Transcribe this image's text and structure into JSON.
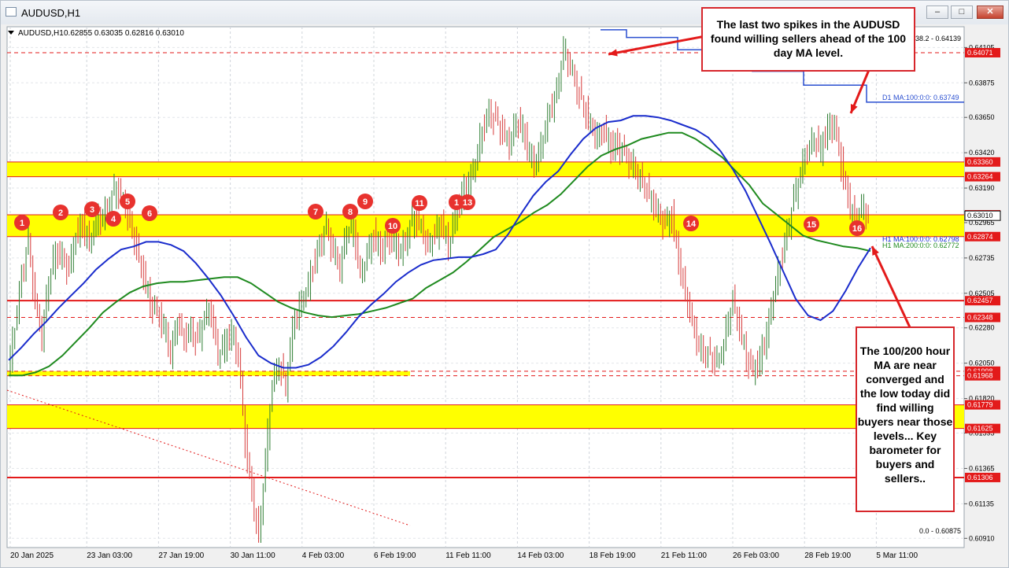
{
  "window": {
    "title": "AUDUSD,H1",
    "buttons": [
      "minimize",
      "maximize",
      "close"
    ]
  },
  "header_info": {
    "symbol": "AUDUSD,H1",
    "ohlc": "0.62855 0.63035 0.62816 0.63010",
    "fib_top_label": "38.2 - 0.64139",
    "fib_bottom_label": "0.0 - 0.60875"
  },
  "annotations": {
    "top": "The last two spikes in the AUDUSD found willing sellers ahead of the 100 day MA level.",
    "bottom": "The 100/200 hour MA are near converged and the low today did find willing buyers near those levels... Key barometer for buyers and sellers.."
  },
  "colors": {
    "price_up": "#2e7d32",
    "price_down": "#d63a3a",
    "ma100h": "#1a2ccc",
    "ma200h": "#1f8a1f",
    "d1ma": "#2a4fd0",
    "zone": "#ffff00",
    "level": "#e31a1a",
    "marker": "#e8322e"
  },
  "chart_data": {
    "type": "candlestick",
    "symbol": "AUDUSD",
    "timeframe": "H1",
    "y_range": [
      0.6085,
      0.6424
    ],
    "y_ticks": [
      "0.64105",
      "0.63875",
      "0.63650",
      "0.63420",
      "0.63190",
      "0.62965",
      "0.62735",
      "0.62505",
      "0.62280",
      "0.62050",
      "0.61820",
      "0.61595",
      "0.61365",
      "0.61135",
      "0.60910"
    ],
    "x_labels": [
      "20 Jan 2025",
      "23 Jan 03:00",
      "27 Jan 19:00",
      "30 Jan 11:00",
      "4 Feb 03:00",
      "6 Feb 19:00",
      "11 Feb 11:00",
      "14 Feb 03:00",
      "18 Feb 19:00",
      "21 Feb 11:00",
      "26 Feb 03:00",
      "28 Feb 19:00",
      "5 Mar 11:00"
    ],
    "highlighted_levels": [
      {
        "price": 0.64071,
        "label": "0.64071",
        "style": "dashed"
      },
      {
        "price": 0.6336,
        "label": "0.63360",
        "style": "zone-top"
      },
      {
        "price": 0.63264,
        "label": "0.63264",
        "style": "zone-bottom"
      },
      {
        "price": 0.63016,
        "label": "0.63016",
        "style": "zone-top"
      },
      {
        "price": 0.62874,
        "label": "0.62874",
        "style": "zone-bottom"
      },
      {
        "price": 0.62457,
        "label": "0.62457",
        "style": "solid"
      },
      {
        "price": 0.62348,
        "label": "0.62348",
        "style": "dashed"
      },
      {
        "price": 0.61998,
        "label": "0.61998",
        "style": "dashed"
      },
      {
        "price": 0.61968,
        "label": "0.61968",
        "style": "dashed"
      },
      {
        "price": 0.61779,
        "label": "0.61779",
        "style": "zone-top"
      },
      {
        "price": 0.61625,
        "label": "0.61625",
        "style": "zone-bottom"
      },
      {
        "price": 0.61306,
        "label": "0.61306",
        "style": "solid"
      }
    ],
    "current_price": 0.6301,
    "indicators": [
      {
        "name": "D1 MA:100:0:0",
        "value": 0.63749,
        "label": "D1 MA:100:0:0: 0.63749"
      },
      {
        "name": "H1 MA:100:0:0",
        "value": 0.62798,
        "label": "H1 MA:100:0:0: 0.62798"
      },
      {
        "name": "H1 MA:200:0:0",
        "value": 0.62772,
        "label": "H1 MA:200:0:0: 0.62772"
      }
    ],
    "markers": [
      "1",
      "2",
      "3",
      "4",
      "5",
      "6",
      "7",
      "8",
      "9",
      "10",
      "11",
      "1",
      "13",
      "14",
      "15",
      "16"
    ],
    "price_path": [
      0.6199,
      0.6228,
      0.6262,
      0.6282,
      0.6245,
      0.6223,
      0.6258,
      0.6278,
      0.6274,
      0.6265,
      0.6288,
      0.6295,
      0.6282,
      0.6298,
      0.63,
      0.631,
      0.632,
      0.631,
      0.6296,
      0.6278,
      0.6262,
      0.6245,
      0.6238,
      0.6229,
      0.6212,
      0.6232,
      0.6222,
      0.6226,
      0.6218,
      0.6235,
      0.6239,
      0.621,
      0.6218,
      0.6225,
      0.621,
      0.6155,
      0.612,
      0.6091,
      0.614,
      0.6192,
      0.6206,
      0.619,
      0.6228,
      0.6242,
      0.625,
      0.6268,
      0.6282,
      0.6292,
      0.6278,
      0.6268,
      0.6291,
      0.6293,
      0.6262,
      0.6274,
      0.6288,
      0.6278,
      0.6285,
      0.6283,
      0.6277,
      0.629,
      0.6301,
      0.6293,
      0.628,
      0.6288,
      0.6296,
      0.6282,
      0.63,
      0.6315,
      0.6323,
      0.6335,
      0.6357,
      0.6368,
      0.6362,
      0.6355,
      0.6348,
      0.6362,
      0.6358,
      0.634,
      0.6335,
      0.6352,
      0.637,
      0.638,
      0.6408,
      0.6398,
      0.6385,
      0.6372,
      0.636,
      0.6352,
      0.6356,
      0.6345,
      0.6348,
      0.634,
      0.6335,
      0.6328,
      0.632,
      0.6312,
      0.6302,
      0.6295,
      0.63,
      0.6272,
      0.625,
      0.6232,
      0.6215,
      0.6212,
      0.6209,
      0.6206,
      0.6225,
      0.6245,
      0.6228,
      0.621,
      0.62,
      0.6208,
      0.6225,
      0.6249,
      0.627,
      0.629,
      0.631,
      0.6328,
      0.6345,
      0.635,
      0.6345,
      0.6358,
      0.636,
      0.6335,
      0.6312,
      0.6298,
      0.6305,
      0.6301
    ],
    "ma100_path": [
      0.6207,
      0.6215,
      0.6224,
      0.6232,
      0.6241,
      0.6249,
      0.6257,
      0.6266,
      0.6273,
      0.6279,
      0.6281,
      0.6284,
      0.6284,
      0.6282,
      0.6278,
      0.627,
      0.626,
      0.6249,
      0.6236,
      0.6222,
      0.621,
      0.6205,
      0.6202,
      0.6202,
      0.6204,
      0.6209,
      0.6216,
      0.6225,
      0.6235,
      0.6243,
      0.625,
      0.6258,
      0.6264,
      0.6269,
      0.6272,
      0.6273,
      0.6274,
      0.6274,
      0.6276,
      0.6279,
      0.6289,
      0.6302,
      0.6314,
      0.6323,
      0.633,
      0.6341,
      0.6351,
      0.6358,
      0.6362,
      0.6363,
      0.6366,
      0.6366,
      0.6365,
      0.6363,
      0.636,
      0.6357,
      0.6352,
      0.6343,
      0.6331,
      0.6317,
      0.63,
      0.6283,
      0.6265,
      0.6247,
      0.6236,
      0.6233,
      0.6239,
      0.6252,
      0.6267,
      0.628
    ],
    "ma200_path": [
      0.6197,
      0.6197,
      0.6199,
      0.6203,
      0.621,
      0.6219,
      0.6228,
      0.6238,
      0.6245,
      0.6251,
      0.6255,
      0.6257,
      0.6258,
      0.6258,
      0.6259,
      0.626,
      0.6261,
      0.6261,
      0.6257,
      0.6251,
      0.6245,
      0.6241,
      0.6238,
      0.6236,
      0.6235,
      0.6236,
      0.6237,
      0.6239,
      0.6241,
      0.6244,
      0.6247,
      0.6254,
      0.6259,
      0.6264,
      0.6271,
      0.6279,
      0.6287,
      0.6292,
      0.6297,
      0.6303,
      0.6308,
      0.6315,
      0.6324,
      0.6333,
      0.634,
      0.6344,
      0.6347,
      0.6351,
      0.6353,
      0.6355,
      0.6355,
      0.6351,
      0.6345,
      0.6339,
      0.633,
      0.6321,
      0.6309,
      0.6302,
      0.6295,
      0.6288,
      0.6285,
      0.6283,
      0.6281,
      0.628,
      0.6278
    ]
  }
}
